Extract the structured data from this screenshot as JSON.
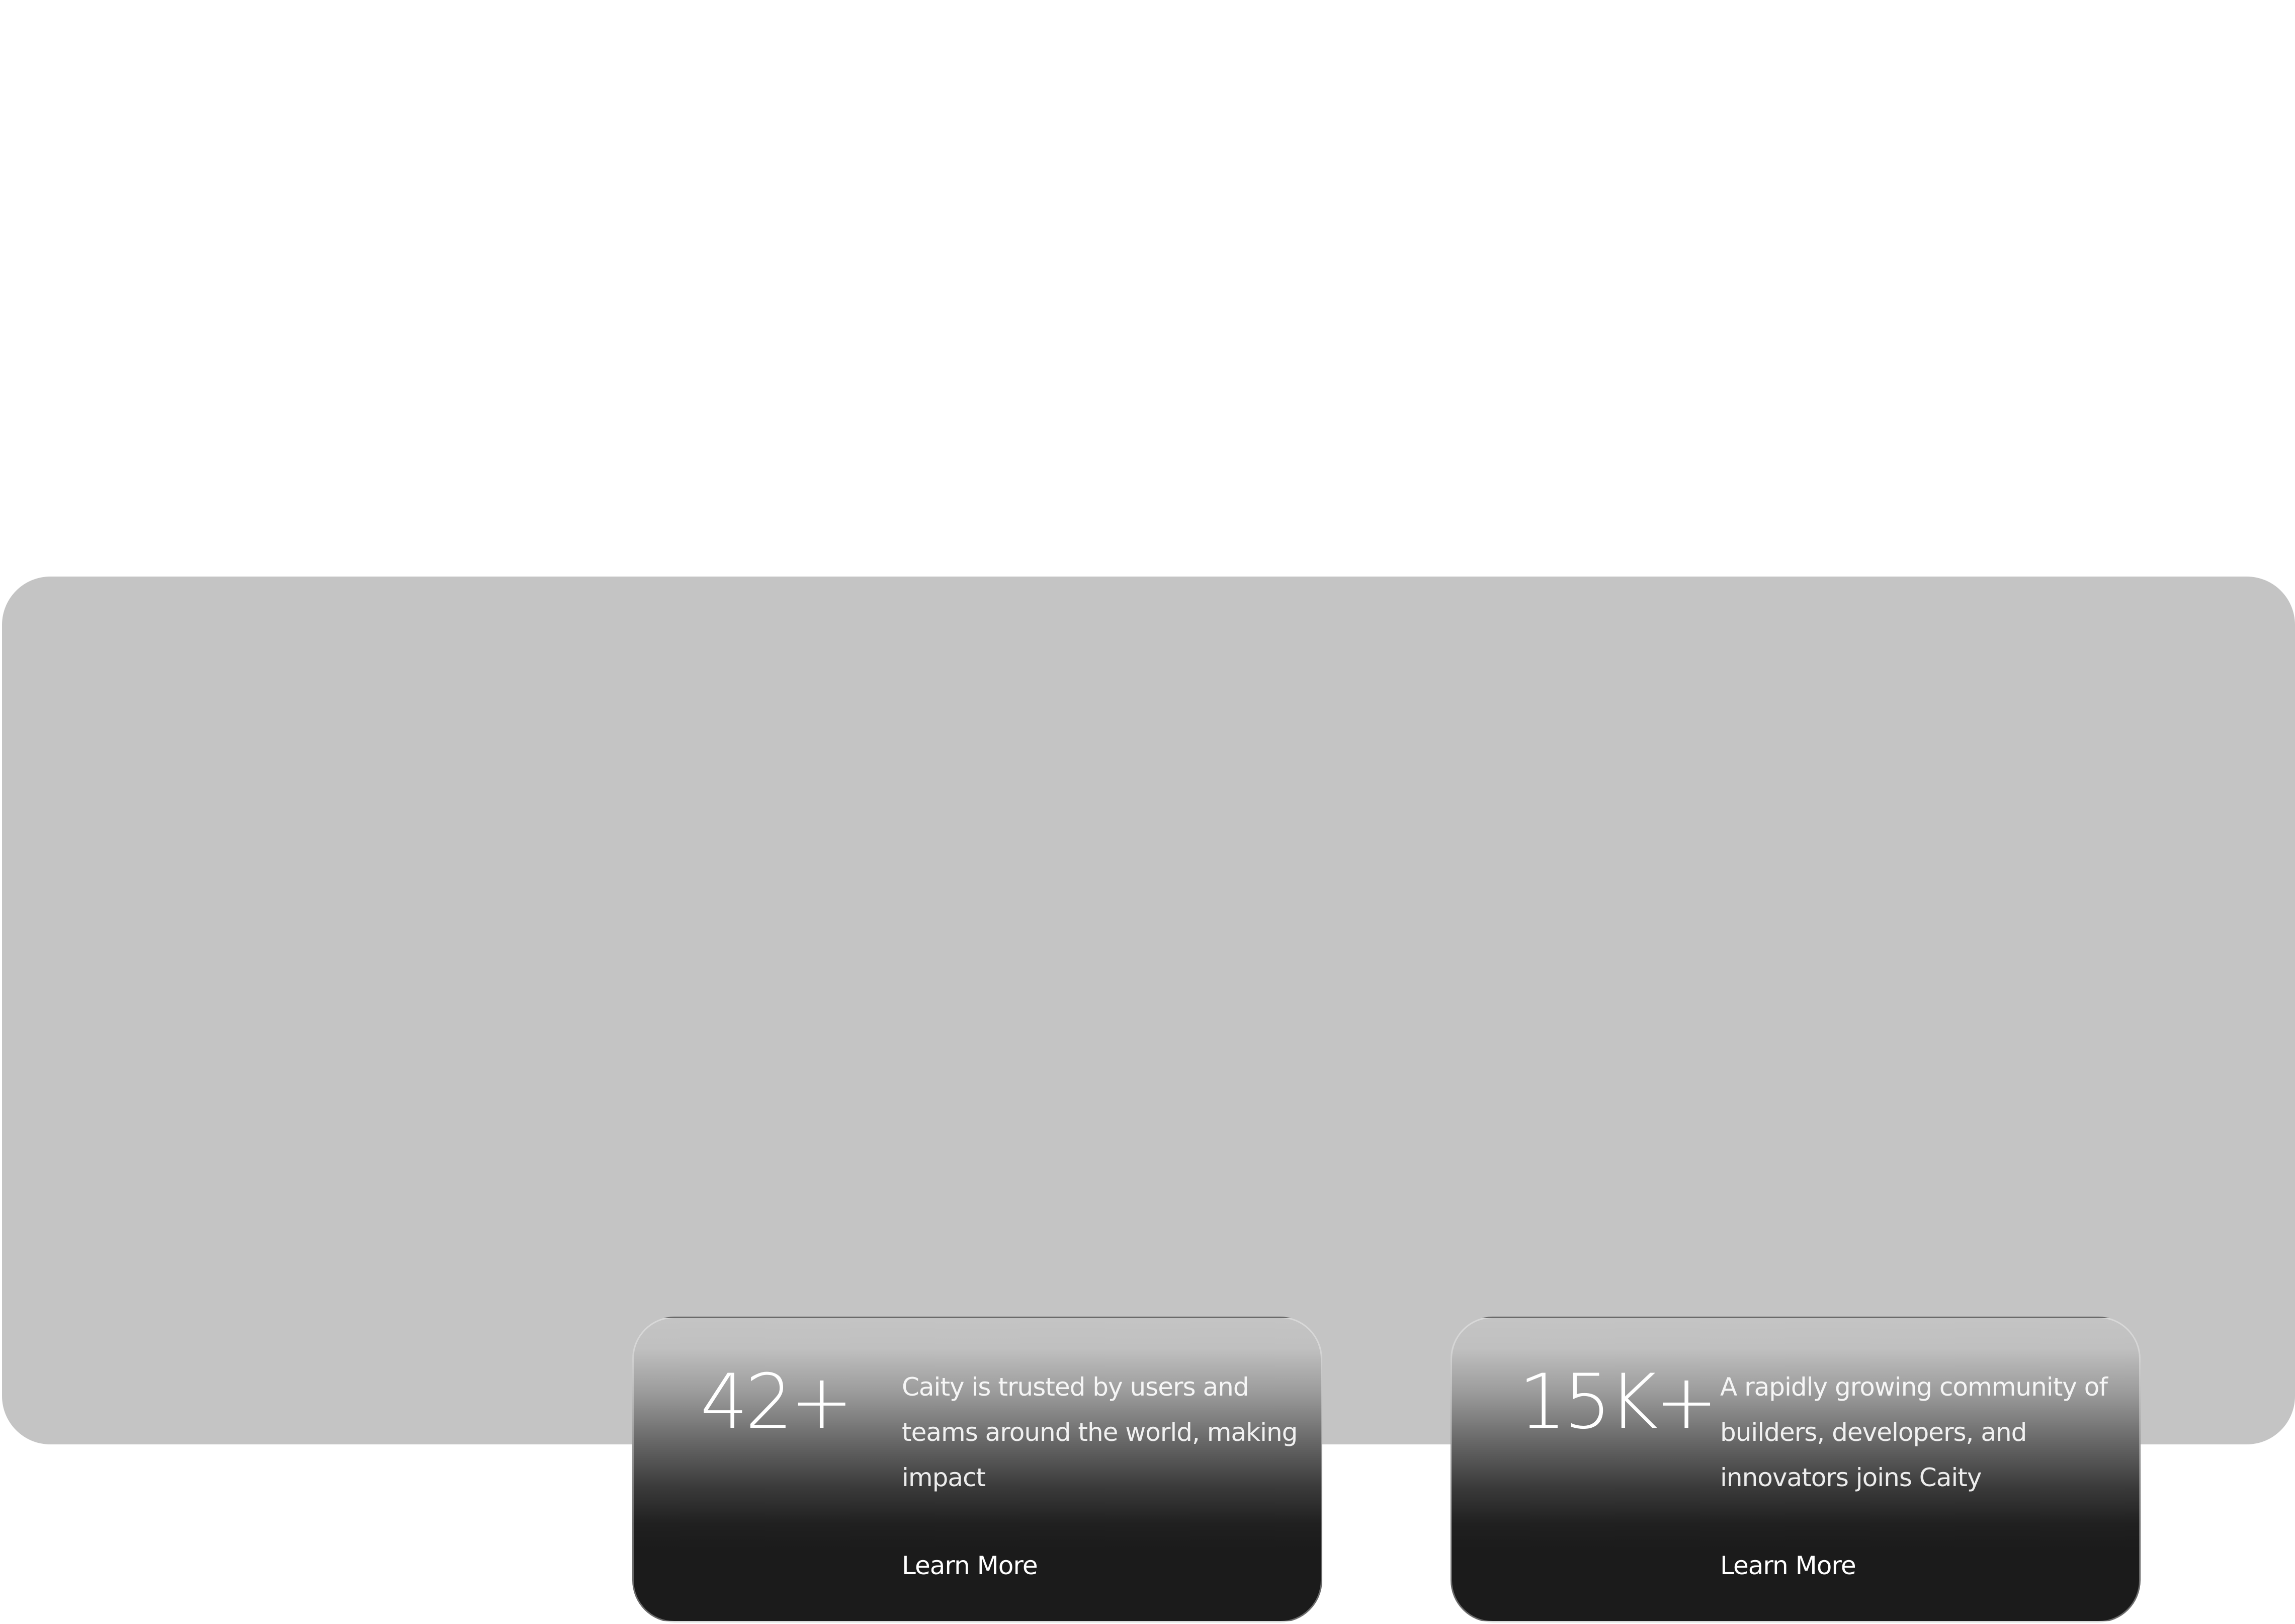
{
  "hero": {
    "background_color": "#c4c4c4",
    "play_button": {
      "icon": "play-icon"
    }
  },
  "stats": [
    {
      "value": "42+",
      "description": "Caity is trusted by users and teams around the world, making impact",
      "link_label": "Learn More"
    },
    {
      "value": "15K+",
      "description": "A rapidly growing community of builders, developers, and innovators joins Caity",
      "link_label": "Learn More"
    }
  ],
  "colors": {
    "card_dark": "#1b1b1b",
    "text": "#ffffff"
  }
}
